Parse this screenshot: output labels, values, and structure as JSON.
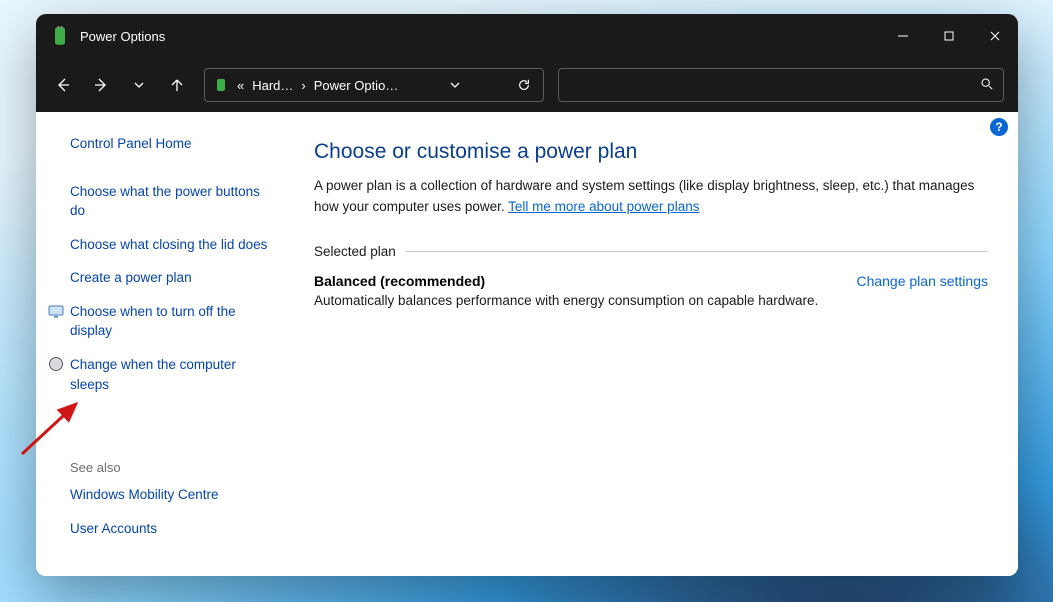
{
  "window": {
    "title": "Power Options"
  },
  "breadcrumb": {
    "chevrons": "«",
    "seg1": "Hard…",
    "sep": "›",
    "seg2": "Power Optio…"
  },
  "search": {
    "placeholder": ""
  },
  "sidebar": {
    "home": "Control Panel Home",
    "links": [
      "Choose what the power buttons do",
      "Choose what closing the lid does",
      "Create a power plan",
      "Choose when to turn off the display",
      "Change when the computer sleeps"
    ],
    "seeAlsoLabel": "See also",
    "seeAlso": [
      "Windows Mobility Centre",
      "User Accounts"
    ]
  },
  "main": {
    "heading": "Choose or customise a power plan",
    "descPre": "A power plan is a collection of hardware and system settings (like display brightness, sleep, etc.) that manages how your computer uses power. ",
    "learnMore": "Tell me more about power plans",
    "sectionLabel": "Selected plan",
    "plan": {
      "name": "Balanced (recommended)",
      "change": "Change plan settings",
      "desc": "Automatically balances performance with energy consumption on capable hardware."
    }
  },
  "help": "?"
}
